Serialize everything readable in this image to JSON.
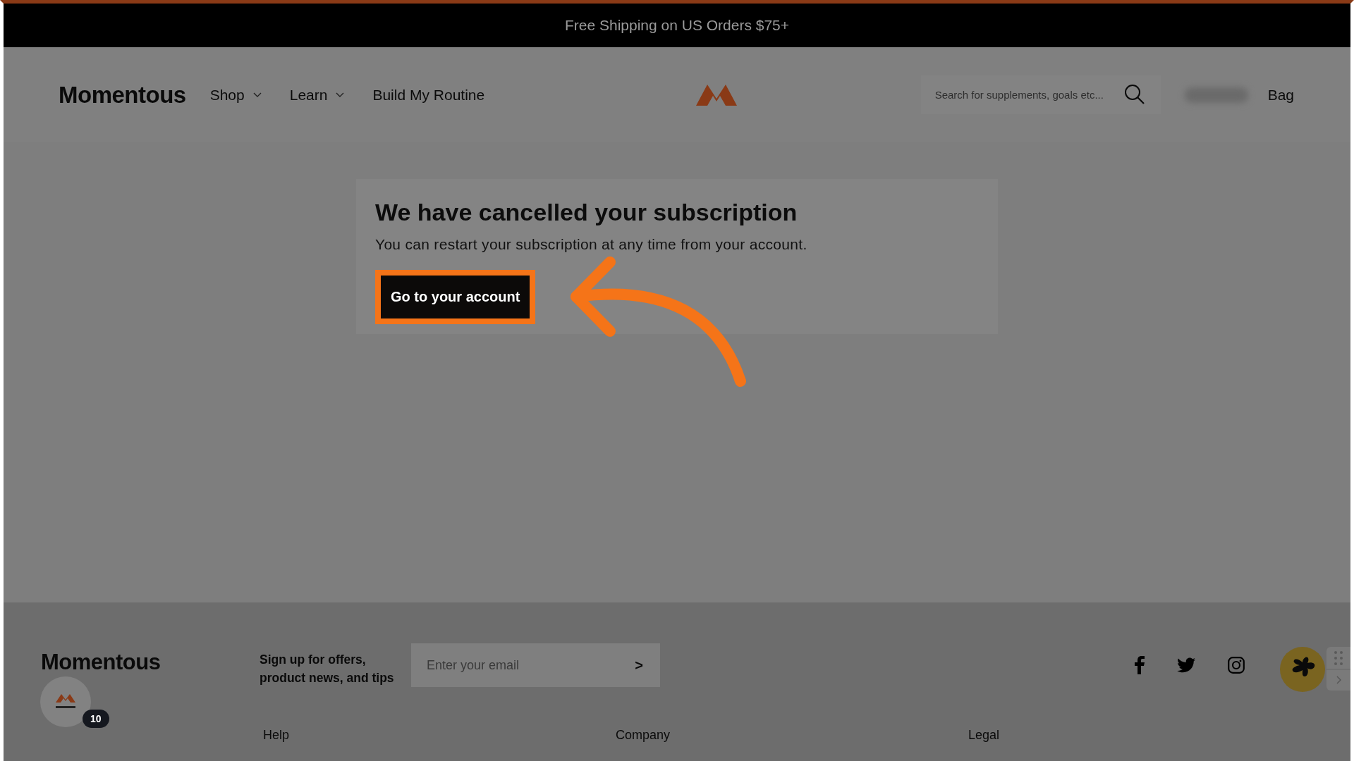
{
  "announcement": "Free Shipping on US Orders $75+",
  "header": {
    "logo": "Momentous",
    "nav": [
      {
        "label": "Shop",
        "dropdown": true
      },
      {
        "label": "Learn",
        "dropdown": true
      },
      {
        "label": "Build My Routine",
        "dropdown": false
      }
    ],
    "search": {
      "placeholder": "Search for supplements, goals etc..."
    },
    "bag": "Bag"
  },
  "card": {
    "title": "We have cancelled your subscription",
    "message": "You can restart your subscription at any time from your account.",
    "button": "Go to your account"
  },
  "footer": {
    "logo": "Momentous",
    "rewards_count": "10",
    "signup": "Sign up for offers, product news, and tips",
    "email": {
      "placeholder": "Enter your email"
    },
    "submit": ">",
    "columns": [
      "Help",
      "Company",
      "Legal"
    ]
  }
}
